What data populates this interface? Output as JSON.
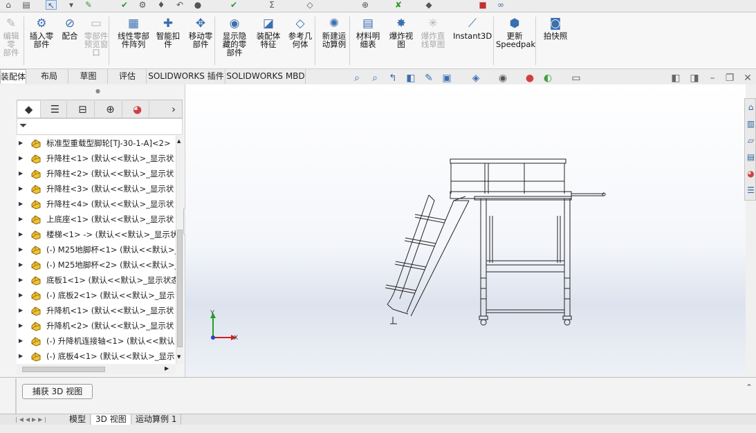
{
  "ribbon": {
    "items": [
      {
        "label": "编辑零\n部件",
        "icon": "edit-component-icon",
        "disabled": true
      },
      {
        "label": "插入零\n部件",
        "icon": "insert-component-icon",
        "disabled": false
      },
      {
        "label": "配合",
        "icon": "mate-icon",
        "disabled": false
      },
      {
        "label": "零部件\n预览窗\n口",
        "icon": "component-preview-icon",
        "disabled": true
      },
      {
        "label": "线性零部\n件阵列",
        "icon": "linear-pattern-icon",
        "disabled": false
      },
      {
        "label": "智能扣\n件",
        "icon": "smart-fasteners-icon",
        "disabled": false
      },
      {
        "label": "移动零\n部件",
        "icon": "move-component-icon",
        "disabled": false
      },
      {
        "label": "显示隐\n藏的零\n部件",
        "icon": "show-hidden-icon",
        "disabled": false
      },
      {
        "label": "装配体\n特征",
        "icon": "assembly-features-icon",
        "disabled": false
      },
      {
        "label": "参考几\n何体",
        "icon": "reference-geometry-icon",
        "disabled": false
      },
      {
        "label": "新建运\n动算例",
        "icon": "new-motion-study-icon",
        "disabled": false
      },
      {
        "label": "材料明\n细表",
        "icon": "bom-icon",
        "disabled": false
      },
      {
        "label": "爆炸视\n图",
        "icon": "exploded-view-icon",
        "disabled": false
      },
      {
        "label": "爆炸直\n线草图",
        "icon": "explode-line-sketch-icon",
        "disabled": true
      },
      {
        "label": "Instant3D",
        "icon": "instant3d-icon",
        "disabled": false
      },
      {
        "label": "更新\nSpeedpak",
        "icon": "speedpak-icon",
        "disabled": false
      },
      {
        "label": "拍快照",
        "icon": "snapshot-icon",
        "disabled": false
      }
    ]
  },
  "tabs": [
    "装配体",
    "布局",
    "草图",
    "评估",
    "SOLIDWORKS 插件",
    "SOLIDWORKS MBD"
  ],
  "active_tab": "装配体",
  "tree": {
    "items": [
      "标准型重载型脚轮[TJ-30-1-A]<2>",
      "升降柱<1> (默认<<默认>_显示状",
      "升降柱<2> (默认<<默认>_显示状",
      "升降柱<3> (默认<<默认>_显示状",
      "升降柱<4> (默认<<默认>_显示状",
      "上底座<1> (默认<<默认>_显示状",
      "楼梯<1> -> (默认<<默认>_显示状",
      "(-) M25地脚杯<1> (默认<<默认>_",
      "(-) M25地脚杯<2> (默认<<默认>_",
      "底板1<1> (默认<<默认>_显示状态",
      "(-) 底板2<1> (默认<<默认>_显示",
      "升降机<1> (默认<<默认>_显示状",
      "升降机<2> (默认<<默认>_显示状",
      "(-) 升降机连接轴<1> (默认<<默认",
      "(-) 底板4<1> (默认<<默认>_显示"
    ]
  },
  "triad": {
    "x_label": "X",
    "y_label": "Y"
  },
  "bottom": {
    "capture_button": "捕获 3D 视图",
    "tabs": [
      "模型",
      "3D 视图",
      "运动算例 1"
    ],
    "active_tab": "3D 视图"
  },
  "colors": {
    "accent": "#2f6db5",
    "triad_x": "#d02020",
    "triad_y": "#20a020",
    "triad_z": "#2040d0"
  }
}
